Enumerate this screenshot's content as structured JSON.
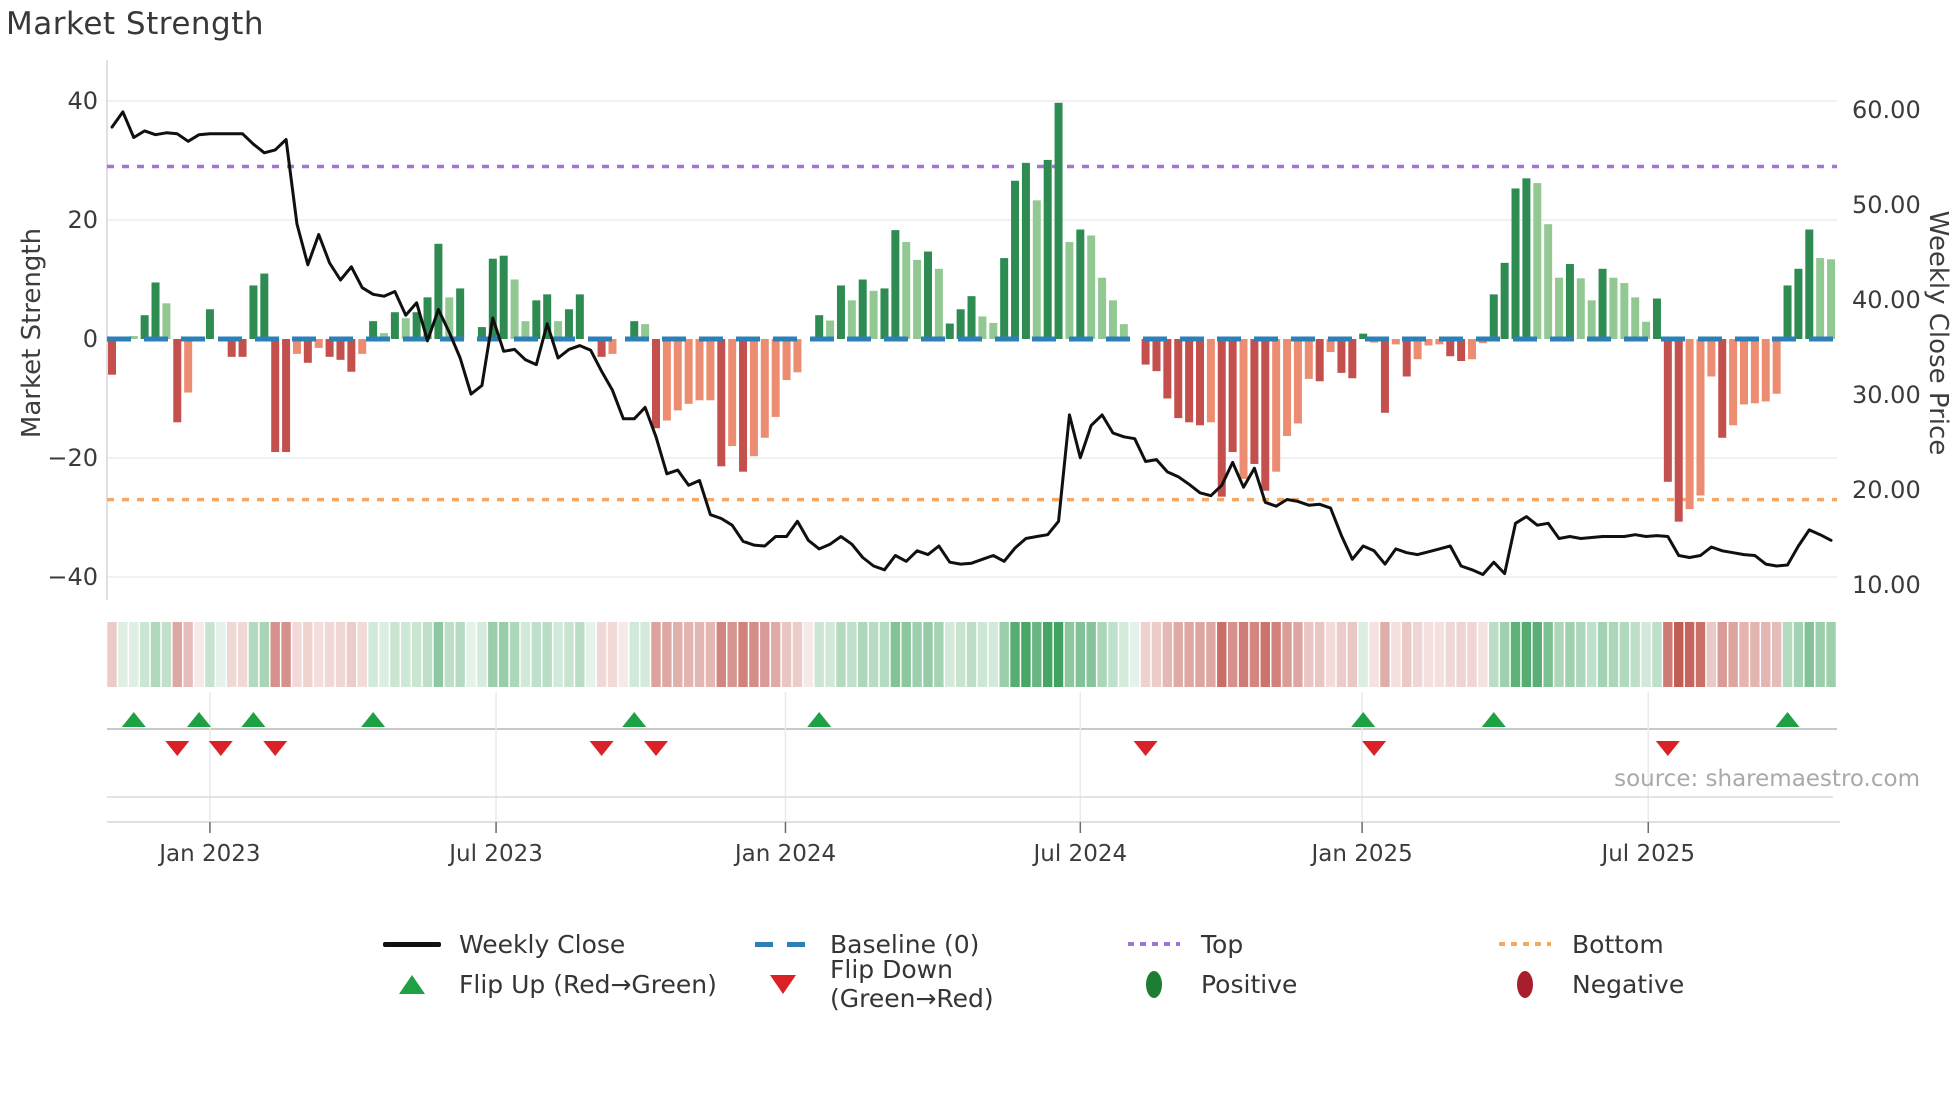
{
  "title": "Market Strength",
  "source_text": "source: sharemaestro.com",
  "axes": {
    "left": {
      "label": "Market Strength",
      "ticks": [
        "40",
        "20",
        "0",
        "−20",
        "−40"
      ],
      "tick_values": [
        40,
        20,
        0,
        -20,
        -40
      ]
    },
    "right": {
      "label": "Weekly Close Price",
      "ticks": [
        "60.00",
        "50.00",
        "40.00",
        "30.00",
        "20.00",
        "10.00"
      ],
      "tick_values": [
        60,
        50,
        40,
        30,
        20,
        10
      ]
    },
    "x": {
      "ticks": [
        "Jan 2023",
        "Jul 2023",
        "Jan 2024",
        "Jul 2024",
        "Jan 2025",
        "Jul 2025"
      ],
      "tick_weeks": [
        9,
        35.3,
        61.9,
        89,
        114.9,
        141.2
      ]
    }
  },
  "legend": {
    "weekly_close": "Weekly Close",
    "baseline": "Baseline (0)",
    "top": "Top",
    "bottom": "Bottom",
    "flip_up": "Flip Up (Red→Green)",
    "flip_down": "Flip Down (Green→Red)",
    "positive": "Positive",
    "negative": "Negative"
  },
  "colors": {
    "bar_positive_strong": "#2e8b52",
    "bar_positive_soft": "#92c993",
    "bar_negative_strong": "#c4504e",
    "bar_negative_soft": "#ec8d72",
    "baseline_line": "#2d7fb8",
    "top_line": "#a374d8",
    "bottom_line": "#f5a860",
    "price_line": "#101010",
    "flip_up_marker": "#1da143",
    "flip_down_marker": "#da2127",
    "positive_dot": "#1e7d34",
    "negative_dot": "#a81e2c",
    "grid": "#ebebf2",
    "spine": "#d5d5dd",
    "axis_text": "#3b3b3b",
    "heat_green_base": [
      40,
      150,
      75
    ],
    "heat_red_base": [
      185,
      70,
      60
    ]
  },
  "chart_data": {
    "type": "bar+line combo, weekly",
    "n_weeks": 159,
    "series": [
      {
        "name": "Market Strength",
        "type": "bar",
        "axis": "left",
        "values": [
          -6,
          0.4,
          0.5,
          4,
          9.5,
          6,
          -14,
          -9,
          0,
          5,
          0,
          -3,
          -3,
          9,
          11,
          -19,
          -19,
          -2.5,
          -4,
          -1.5,
          -3,
          -3.5,
          -5.5,
          -2.5,
          3,
          1,
          4.5,
          3.5,
          4.5,
          7,
          16,
          7,
          8.5,
          0,
          2,
          13.5,
          14,
          10,
          3,
          6.5,
          7.5,
          3,
          5,
          7.5,
          0,
          -3,
          -2.5,
          0,
          3,
          2.5,
          -15,
          -13.7,
          -12,
          -10.9,
          -10.3,
          -10.3,
          -21.4,
          -18,
          -22.3,
          -19.7,
          -16.6,
          -13.1,
          -6.9,
          -5.6,
          0,
          4,
          3.1,
          9,
          6.5,
          10,
          8.1,
          8.5,
          18.3,
          16.3,
          13.3,
          14.7,
          11.8,
          2.6,
          5,
          7.2,
          3.8,
          2.7,
          13.6,
          26.6,
          29.6,
          23.3,
          30.1,
          39.7,
          16.3,
          18.4,
          17.4,
          10.3,
          6.5,
          2.5,
          0,
          -4.3,
          -5.4,
          -10,
          -13.3,
          -14,
          -14.5,
          -14,
          -26.5,
          -19,
          -23.5,
          -21,
          -25.5,
          -22.3,
          -16.3,
          -14.2,
          -6.7,
          -7.1,
          -2.2,
          -5.7,
          -6.6,
          0.9,
          -0.6,
          -12.4,
          -0.9,
          -6.3,
          -3.4,
          -1.1,
          -0.9,
          -2.9,
          -3.7,
          -3.4,
          -0.7,
          7.5,
          12.8,
          25.3,
          27,
          26.2,
          19.3,
          10.3,
          12.6,
          10.2,
          6.5,
          11.8,
          10.3,
          9.4,
          7,
          2.9,
          6.8,
          -24,
          -30.7,
          -28.6,
          -26.3,
          -6.3,
          -16.6,
          -14.5,
          -11,
          -10.8,
          -10.5,
          -9.2,
          9,
          11.8,
          18.4,
          13.6,
          13.4
        ],
        "palette_codes": "rGGggGrRzgzrrggrrRrRrrrRgGgGgggGgzgggGGggGggzrRzgGrRRRRRrRrRRRRRzgGgGgGggGGgGgggGGgggGggGgGGGGzrrrrrrRrrRrrRRRRrRrrgRrRrRRRrrRRggggGGGgGGgGGGGgrrRRRrRRRRRgggGG",
        "palette_legend": {
          "g": "strong green",
          "G": "soft green",
          "r": "strong red",
          "R": "soft red",
          "z": "zero/no bar"
        }
      },
      {
        "name": "Weekly Close",
        "type": "line",
        "axis": "right",
        "values": [
          58.2,
          59.8,
          57.1,
          57.8,
          57.4,
          57.6,
          57.5,
          56.7,
          57.4,
          57.5,
          57.5,
          57.5,
          57.5,
          56.4,
          55.5,
          55.8,
          56.9,
          48,
          43.7,
          46.9,
          43.9,
          42.1,
          43.5,
          41.3,
          40.6,
          40.4,
          40.9,
          38.4,
          39.7,
          35.7,
          39,
          36.6,
          33.9,
          30.1,
          31,
          38.1,
          34.6,
          34.8,
          33.7,
          33.2,
          37.5,
          33.9,
          34.8,
          35.2,
          34.7,
          32.5,
          30.5,
          27.5,
          27.5,
          28.7,
          25.6,
          21.7,
          22.1,
          20.5,
          21,
          17.4,
          17,
          16.3,
          14.6,
          14.2,
          14.1,
          15.1,
          15.1,
          16.7,
          14.7,
          13.8,
          14.3,
          15.1,
          14.3,
          12.9,
          12,
          11.6,
          13.1,
          12.5,
          13.6,
          13.2,
          14.1,
          12.4,
          12.2,
          12.3,
          12.7,
          13.1,
          12.5,
          13.9,
          14.9,
          15.1,
          15.3,
          16.7,
          27.9,
          23.4,
          26.8,
          27.9,
          26,
          25.6,
          25.4,
          23,
          23.2,
          21.9,
          21.4,
          20.6,
          19.7,
          19.4,
          20.5,
          22.9,
          20.3,
          22.3,
          18.7,
          18.3,
          19,
          18.8,
          18.4,
          18.5,
          18.1,
          15.2,
          12.7,
          14.1,
          13.6,
          12.2,
          13.8,
          13.4,
          13.2,
          13.5,
          13.8,
          14.1,
          12,
          11.6,
          11.1,
          12.4,
          11.2,
          16.5,
          17.2,
          16.3,
          16.5,
          14.9,
          15.1,
          14.9,
          15,
          15.1,
          15.1,
          15.1,
          15.3,
          15.1,
          15.2,
          15.1,
          13.1,
          12.9,
          13.1,
          14,
          13.6,
          13.4,
          13.2,
          13.1,
          12.2,
          12,
          12.1,
          14.1,
          15.8,
          15.3,
          14.7
        ]
      }
    ],
    "reference_lines": [
      {
        "name": "Baseline (0)",
        "axis": "left",
        "value": 0
      },
      {
        "name": "Top",
        "axis": "left",
        "value": 29
      },
      {
        "name": "Bottom",
        "axis": "left",
        "value": -27
      }
    ],
    "flip_up_weeks": [
      2,
      8,
      13,
      24,
      48,
      65,
      115,
      127,
      154
    ],
    "flip_down_weeks": [
      6,
      10,
      15,
      45,
      50,
      95,
      116,
      143
    ],
    "left_axis_range": [
      -47,
      47
    ],
    "right_axis_range": [
      6.3,
      65.3
    ],
    "x_tick_labels": [
      "Jan 2023",
      "Jul 2023",
      "Jan 2024",
      "Jul 2024",
      "Jan 2025",
      "Jul 2025"
    ],
    "x_tick_weeks": [
      9,
      35.3,
      61.9,
      89,
      114.9,
      141.2
    ],
    "heatmap": "strip below main plot, one cell per week, hue = bar sign, intensity ~ |strength|"
  }
}
